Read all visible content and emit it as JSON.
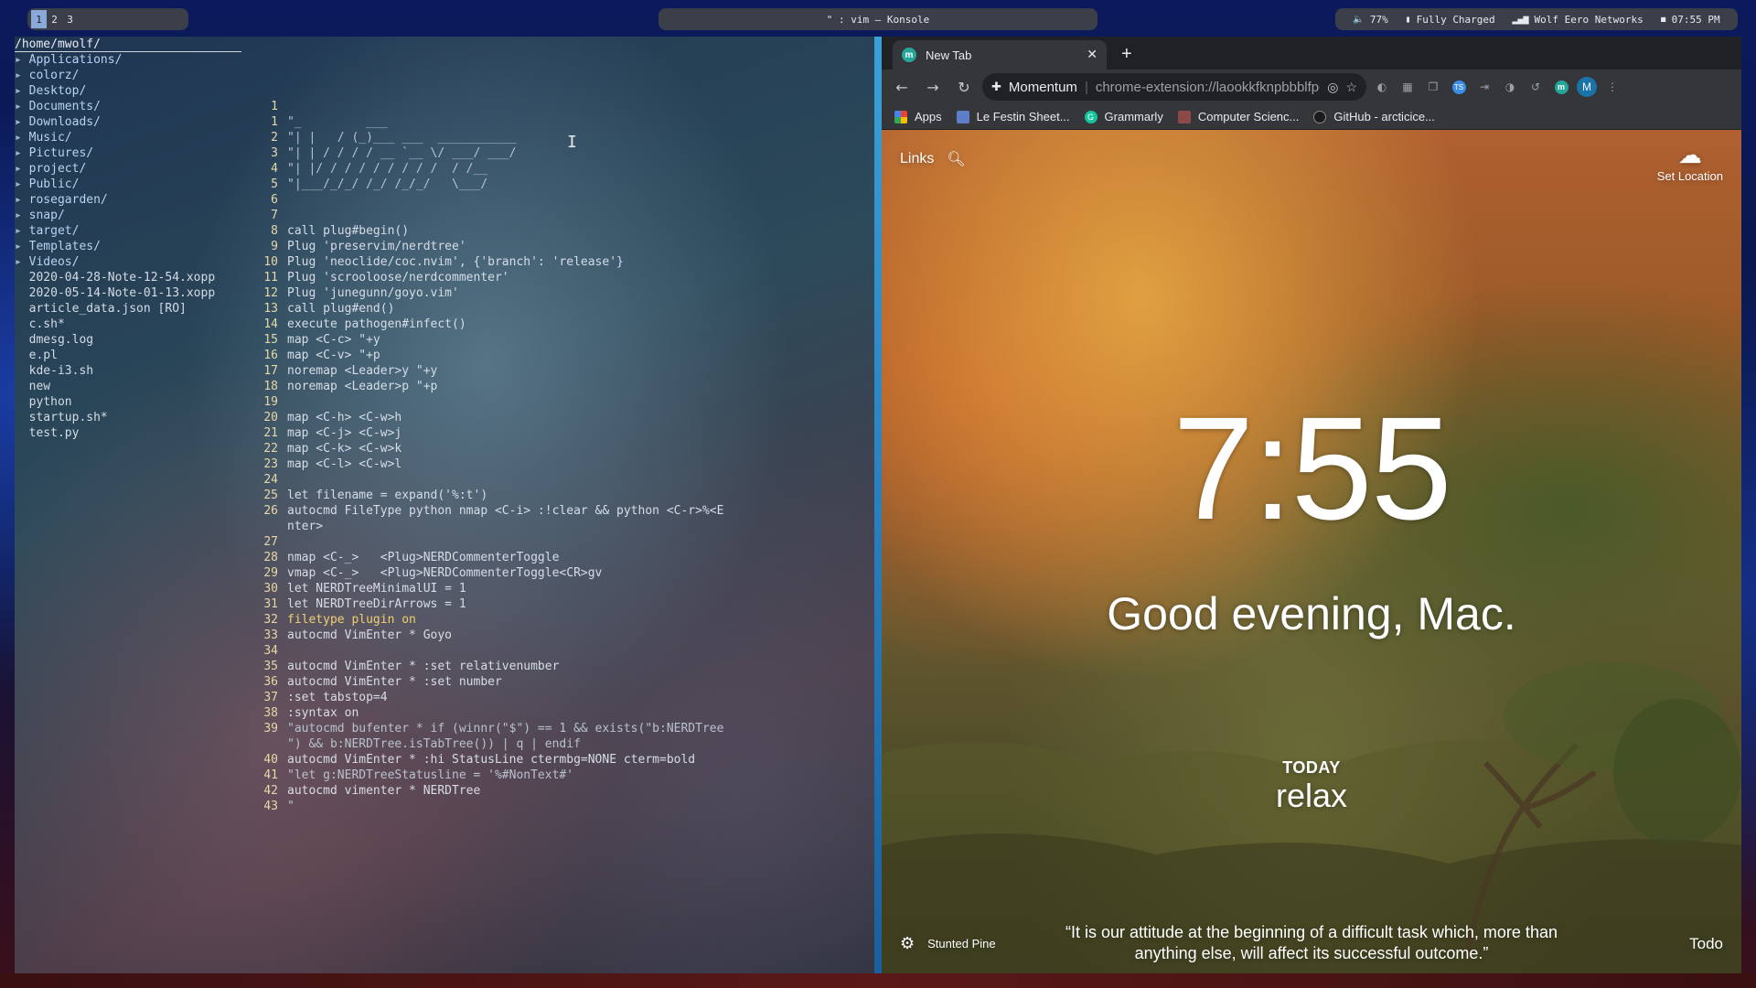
{
  "topbar": {
    "workspaces": [
      "1",
      "2",
      "3"
    ],
    "active_workspace": "1",
    "window_title": "\" : vim — Konsole",
    "status": {
      "volume": "77%",
      "battery": "Fully Charged",
      "network": "Wolf Eero Networks",
      "time": "07:55 PM"
    }
  },
  "terminal": {
    "tree_path": "/home/mwolf/",
    "tree": [
      {
        "name": "Applications/",
        "dir": true
      },
      {
        "name": "colorz/",
        "dir": true
      },
      {
        "name": "Desktop/",
        "dir": true
      },
      {
        "name": "Documents/",
        "dir": true
      },
      {
        "name": "Downloads/",
        "dir": true
      },
      {
        "name": "Music/",
        "dir": true
      },
      {
        "name": "Pictures/",
        "dir": true
      },
      {
        "name": "project/",
        "dir": true
      },
      {
        "name": "Public/",
        "dir": true
      },
      {
        "name": "rosegarden/",
        "dir": true
      },
      {
        "name": "snap/",
        "dir": true
      },
      {
        "name": "target/",
        "dir": true
      },
      {
        "name": "Templates/",
        "dir": true
      },
      {
        "name": "Videos/",
        "dir": true
      },
      {
        "name": "2020-04-28-Note-12-54.xopp",
        "dir": false
      },
      {
        "name": "2020-05-14-Note-01-13.xopp",
        "dir": false
      },
      {
        "name": "article_data.json [RO]",
        "dir": false
      },
      {
        "name": "c.sh*",
        "dir": false
      },
      {
        "name": "dmesg.log",
        "dir": false
      },
      {
        "name": "e.pl",
        "dir": false
      },
      {
        "name": "kde-i3.sh",
        "dir": false
      },
      {
        "name": "new",
        "dir": false
      },
      {
        "name": "python",
        "dir": false
      },
      {
        "name": "startup.sh*",
        "dir": false
      },
      {
        "name": "test.py",
        "dir": false
      }
    ],
    "code_lines": [
      {
        "n": "1",
        "t": "",
        "c": "txt",
        "indent": "left"
      },
      {
        "n": "1",
        "t": "\"_         ___",
        "c": "tk-cmt"
      },
      {
        "n": "2",
        "t": "\"| |   / (_)___ ___  ___________",
        "c": "tk-cmt"
      },
      {
        "n": "3",
        "t": "\"| | / / / / __ `__ \\/ ___/ ___/",
        "c": "tk-cmt"
      },
      {
        "n": "4",
        "t": "\"| |/ / / / / / / / /  / /__",
        "c": "tk-cmt"
      },
      {
        "n": "5",
        "t": "\"|___/_/_/ /_/ /_/_/   \\___/",
        "c": "tk-cmt"
      },
      {
        "n": "6",
        "t": "",
        "c": "txt"
      },
      {
        "n": "7",
        "t": "",
        "c": "txt"
      },
      {
        "n": "8",
        "t": "call plug#begin()",
        "c": "txt"
      },
      {
        "n": "9",
        "t": "Plug 'preservim/nerdtree'",
        "c": "txt"
      },
      {
        "n": "10",
        "t": "Plug 'neoclide/coc.nvim', {'branch': 'release'}",
        "c": "txt"
      },
      {
        "n": "11",
        "t": "Plug 'scrooloose/nerdcommenter'",
        "c": "txt"
      },
      {
        "n": "12",
        "t": "Plug 'junegunn/goyo.vim'",
        "c": "txt"
      },
      {
        "n": "13",
        "t": "call plug#end()",
        "c": "txt"
      },
      {
        "n": "14",
        "t": "execute pathogen#infect()",
        "c": "txt"
      },
      {
        "n": "15",
        "t": "map <C-c> \"+y",
        "c": "txt"
      },
      {
        "n": "16",
        "t": "map <C-v> \"+p",
        "c": "txt"
      },
      {
        "n": "17",
        "t": "noremap <Leader>y \"+y",
        "c": "txt"
      },
      {
        "n": "18",
        "t": "noremap <Leader>p \"+p",
        "c": "txt"
      },
      {
        "n": "19",
        "t": "",
        "c": "txt"
      },
      {
        "n": "20",
        "t": "map <C-h> <C-w>h",
        "c": "txt"
      },
      {
        "n": "21",
        "t": "map <C-j> <C-w>j",
        "c": "txt"
      },
      {
        "n": "22",
        "t": "map <C-k> <C-w>k",
        "c": "txt"
      },
      {
        "n": "23",
        "t": "map <C-l> <C-w>l",
        "c": "txt"
      },
      {
        "n": "24",
        "t": "",
        "c": "txt"
      },
      {
        "n": "25",
        "t": "let filename = expand('%:t')",
        "c": "txt"
      },
      {
        "n": "26",
        "t": "autocmd FileType python nmap <C-i> :!clear && python <C-r>%<E",
        "c": "txt"
      },
      {
        "n": "",
        "t": "nter>",
        "c": "txt"
      },
      {
        "n": "27",
        "t": "",
        "c": "txt"
      },
      {
        "n": "28",
        "t": "nmap <C-_>   <Plug>NERDCommenterToggle",
        "c": "txt"
      },
      {
        "n": "29",
        "t": "vmap <C-_>   <Plug>NERDCommenterToggle<CR>gv",
        "c": "txt"
      },
      {
        "n": "30",
        "t": "let NERDTreeMinimalUI = 1",
        "c": "txt"
      },
      {
        "n": "31",
        "t": "let NERDTreeDirArrows = 1",
        "c": "txt"
      },
      {
        "n": "32",
        "t": "filetype plugin on",
        "c": "tk-ev"
      },
      {
        "n": "33",
        "t": "autocmd VimEnter * Goyo",
        "c": "txt"
      },
      {
        "n": "34",
        "t": "",
        "c": "txt"
      },
      {
        "n": "35",
        "t": "autocmd VimEnter * :set relativenumber",
        "c": "txt"
      },
      {
        "n": "36",
        "t": "autocmd VimEnter * :set number",
        "c": "txt"
      },
      {
        "n": "37",
        "t": ":set tabstop=4",
        "c": "txt"
      },
      {
        "n": "38",
        "t": ":syntax on",
        "c": "txt"
      },
      {
        "n": "39",
        "t": "\"autocmd bufenter * if (winnr(\"$\") == 1 && exists(\"b:NERDTree",
        "c": "tk-cmt"
      },
      {
        "n": "",
        "t": "\") && b:NERDTree.isTabTree()) | q | endif",
        "c": "tk-cmt"
      },
      {
        "n": "40",
        "t": "autocmd VimEnter * :hi StatusLine ctermbg=NONE cterm=bold",
        "c": "txt"
      },
      {
        "n": "41",
        "t": "\"let g:NERDTreeStatusline = '%#NonText#'",
        "c": "tk-cmt"
      },
      {
        "n": "42",
        "t": "autocmd vimenter * NERDTree",
        "c": "txt"
      },
      {
        "n": "43",
        "t": "\"",
        "c": "tk-cmt"
      }
    ]
  },
  "browser": {
    "tab_title": "New Tab",
    "omnibox": {
      "origin": "Momentum",
      "url": "chrome-extension://laookkfknpbbblfpciff..."
    },
    "avatar_letter": "M",
    "bookmarks": [
      "Apps",
      "Le Festin Sheet...",
      "Grammarly",
      "Computer Scienc...",
      "GitHub - arcticice..."
    ],
    "momentum": {
      "links_label": "Links",
      "weather_label": "Set Location",
      "clock": "7:55",
      "greeting": "Good evening, Mac.",
      "today_label": "TODAY",
      "focus": "relax",
      "photo_location": "Stunted Pine",
      "quote": "“It is our attitude at the beginning of a difficult task which, more than anything else, will affect its successful outcome.”",
      "todo_label": "Todo"
    }
  }
}
